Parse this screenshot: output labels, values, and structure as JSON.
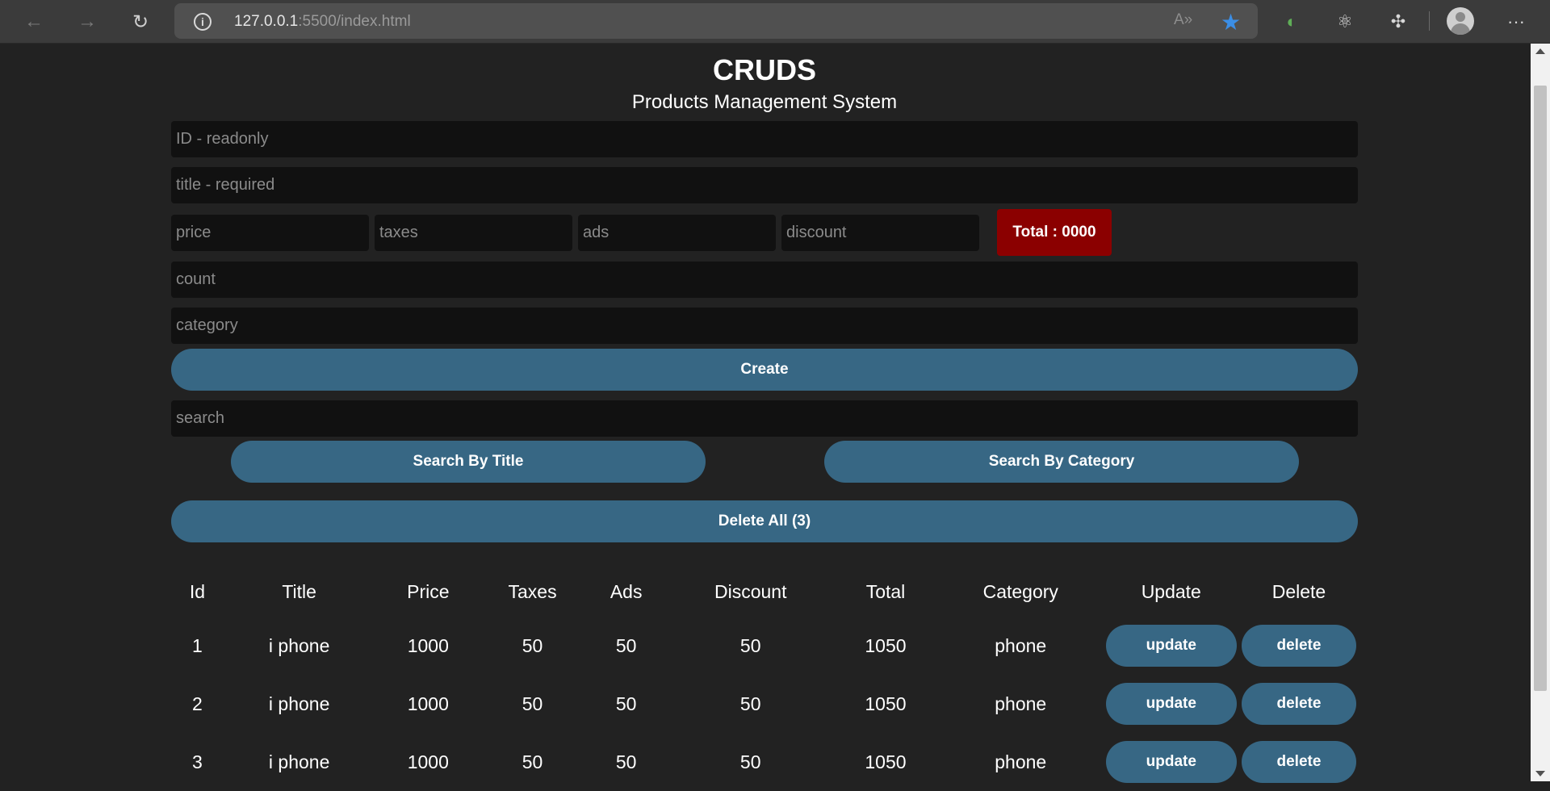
{
  "browser": {
    "url_host": "127.0.0.1",
    "url_rest": ":5500/index.html",
    "back_icon": "←",
    "forward_icon": "→",
    "refresh_icon": "↻",
    "info_icon": "i",
    "read_aloud_icon": "A»",
    "favorite_icon": "★",
    "ext1_icon": "◐",
    "ext2_icon": "⚛",
    "ext3_icon": "✣",
    "more_icon": "···"
  },
  "header": {
    "title": "CRUDS",
    "subtitle": "Products Management System"
  },
  "form": {
    "id_placeholder": "ID - readonly",
    "title_placeholder": "title - required",
    "price_placeholder": "price",
    "taxes_placeholder": "taxes",
    "ads_placeholder": "ads",
    "discount_placeholder": "discount",
    "total_label": "Total : 0000",
    "count_placeholder": "count",
    "category_placeholder": "category",
    "create_label": "Create",
    "search_placeholder": "search",
    "search_title_label": "Search By Title",
    "search_category_label": "Search By Category",
    "delete_all_label": "Delete All (3)"
  },
  "colors": {
    "accent": "#376784",
    "total_bg": "#8b0000",
    "page_bg": "#222222",
    "input_bg": "#111111"
  },
  "table": {
    "headers": [
      "Id",
      "Title",
      "Price",
      "Taxes",
      "Ads",
      "Discount",
      "Total",
      "Category",
      "Update",
      "Delete"
    ],
    "update_label": "update",
    "delete_label": "delete",
    "rows": [
      {
        "id": "1",
        "title": "i phone",
        "price": "1000",
        "taxes": "50",
        "ads": "50",
        "discount": "50",
        "total": "1050",
        "category": "phone"
      },
      {
        "id": "2",
        "title": "i phone",
        "price": "1000",
        "taxes": "50",
        "ads": "50",
        "discount": "50",
        "total": "1050",
        "category": "phone"
      },
      {
        "id": "3",
        "title": "i phone",
        "price": "1000",
        "taxes": "50",
        "ads": "50",
        "discount": "50",
        "total": "1050",
        "category": "phone"
      }
    ]
  }
}
